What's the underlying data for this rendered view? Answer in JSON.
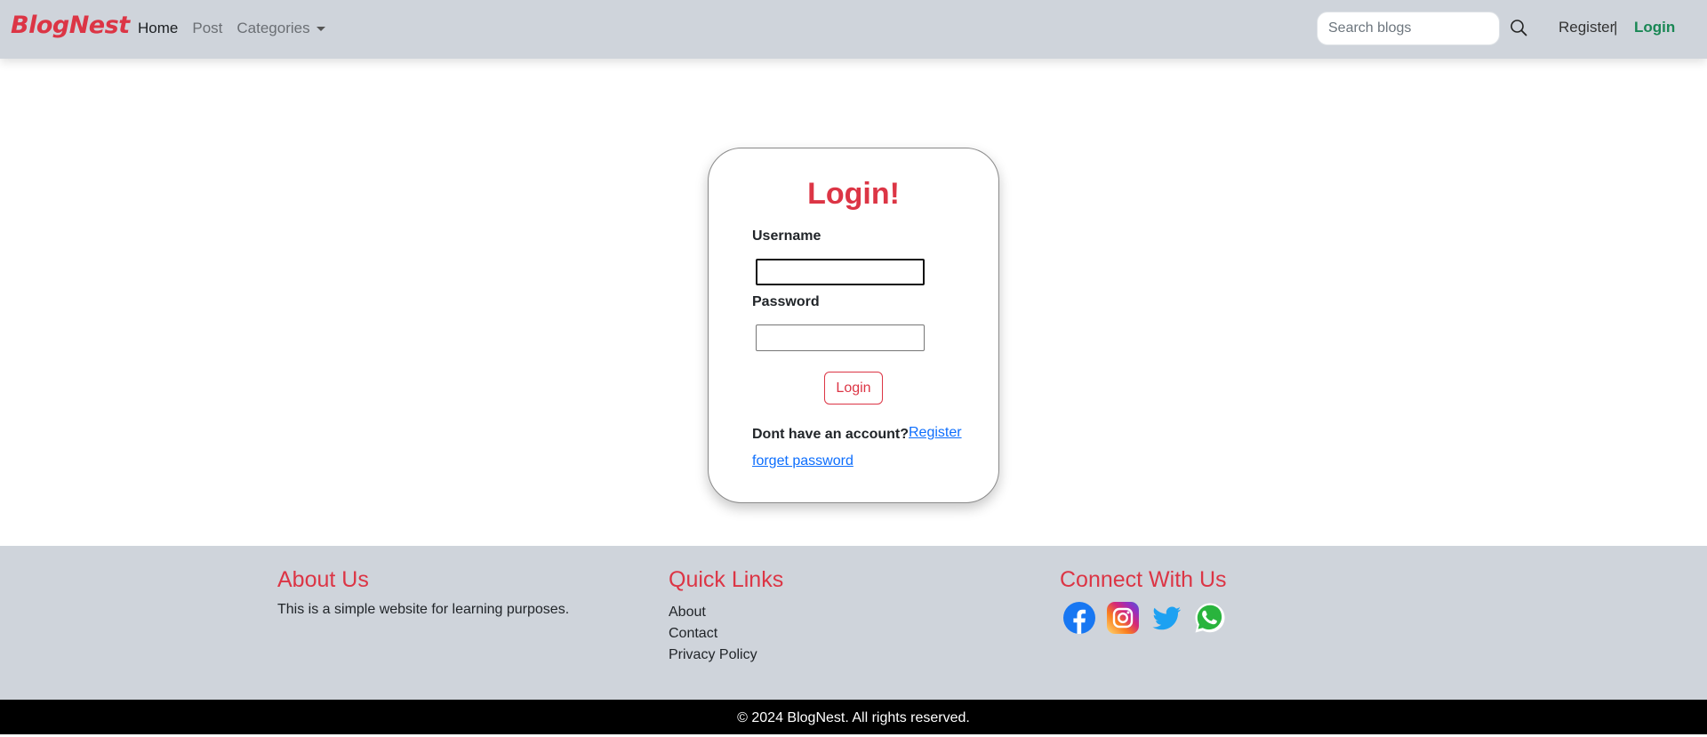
{
  "navbar": {
    "brand": "BlogNest",
    "links": [
      "Home",
      "Post",
      "Categories"
    ],
    "search_placeholder": "Search blogs",
    "register": "Register",
    "separator": "|",
    "login": "Login"
  },
  "login_card": {
    "title": "Login!",
    "username_label": "Username",
    "username_value": "",
    "password_label": "Password",
    "password_value": "",
    "submit": "Login",
    "no_account": "Dont have an account?",
    "register_link": "Register",
    "forget_link": "forget password"
  },
  "footer": {
    "about_heading": "About Us",
    "about_text": "This is a simple website for learning purposes.",
    "links_heading": "Quick Links",
    "links": [
      "About",
      "Contact",
      "Privacy Policy"
    ],
    "connect_heading": "Connect With Us",
    "social": [
      "facebook-icon",
      "instagram-icon",
      "twitter-icon",
      "whatsapp-icon"
    ]
  },
  "copyright": "© 2024 BlogNest. All rights reserved.",
  "colors": {
    "brand_red": "#dc3545",
    "login_green": "#198754",
    "link_blue": "#0d6efd",
    "navbar_bg": "#cfd4db"
  }
}
